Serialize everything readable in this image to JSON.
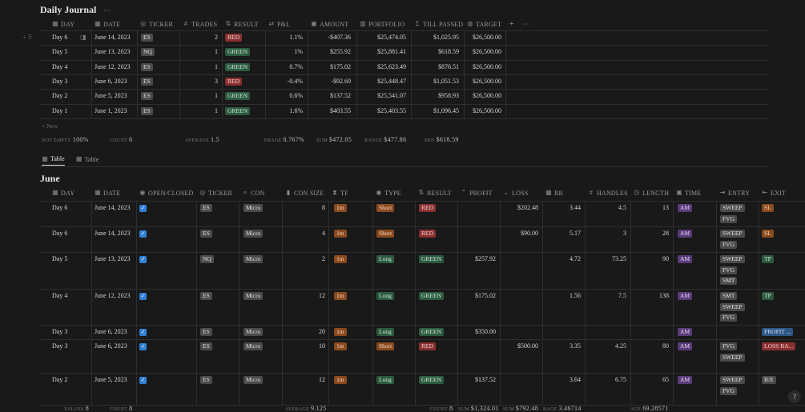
{
  "journal": {
    "title": "Daily Journal",
    "more": "···",
    "add_col": "+",
    "more_col": "···",
    "headers": [
      "DAY",
      "DATE",
      "TICKER",
      "TRADES",
      "RESULT",
      "P&L",
      "AMOUNT",
      "PORTFOLIO",
      "TILL PASSED",
      "TARGET"
    ],
    "rows": [
      {
        "day": "Day 6",
        "date": "June 14, 2023",
        "ticker": "ES",
        "trades": "2",
        "result": "RED",
        "pnl": "1.1%",
        "amount": "-$407.36",
        "portfolio": "$25,474.05",
        "till": "$1,025.95",
        "target": "$26,500.00"
      },
      {
        "day": "Day 5",
        "date": "June 13, 2023",
        "ticker": "NQ",
        "trades": "1",
        "result": "GREEN",
        "pnl": "1%",
        "amount": "$255.92",
        "portfolio": "$25,881.41",
        "till": "$618.59",
        "target": "$26,500.00"
      },
      {
        "day": "Day 4",
        "date": "June 12, 2023",
        "ticker": "ES",
        "trades": "1",
        "result": "GREEN",
        "pnl": "0.7%",
        "amount": "$175.02",
        "portfolio": "$25,623.49",
        "till": "$876.51",
        "target": "$26,500.00"
      },
      {
        "day": "Day 3",
        "date": "June 6, 2023",
        "ticker": "ES",
        "trades": "3",
        "result": "RED",
        "pnl": "-0.4%",
        "amount": "-$92.60",
        "portfolio": "$25,448.47",
        "till": "$1,051.53",
        "target": "$26,500.00"
      },
      {
        "day": "Day 2",
        "date": "June 5, 2023",
        "ticker": "ES",
        "trades": "1",
        "result": "GREEN",
        "pnl": "0.6%",
        "amount": "$137.52",
        "portfolio": "$25,541.07",
        "till": "$958.93",
        "target": "$26,500.00"
      },
      {
        "day": "Day 1",
        "date": "June 1, 2023",
        "ticker": "ES",
        "trades": "1",
        "result": "GREEN",
        "pnl": "1.6%",
        "amount": "$403.55",
        "portfolio": "$25,403.55",
        "till": "$1,096.45",
        "target": "$26,500.00"
      }
    ],
    "new_label": "+ New",
    "footer": {
      "not_empty_label": "NOT EMPTY",
      "not_empty": "100%",
      "count_label": "COUNT",
      "count": "6",
      "average_label": "AVERAGE",
      "average": "1.5",
      "erage_label": "ERAGE",
      "erage": "0.767%",
      "sum_label": "SUM",
      "sum": "$472.05",
      "range_label": "RANGE",
      "range": "$477.86",
      "min_label": "MIN",
      "min": "$618.59"
    }
  },
  "tabs": [
    {
      "label": "Table"
    },
    {
      "label": "Table"
    }
  ],
  "june": {
    "title": "June",
    "headers": [
      "DAY",
      "DATE",
      "OPEN/CLOSED",
      "TICKER",
      "CON",
      "CON SIZE",
      "TF",
      "TYPE",
      "RESULT",
      "PROFIT",
      "LOSS",
      "RR",
      "HANDLES",
      "LENGTH",
      "TIME",
      "ENTRY",
      "EXIT"
    ],
    "rows": [
      {
        "day": "Day 6",
        "date": "June 14, 2023",
        "ticker": "ES",
        "con": "Micro",
        "size": "8",
        "tf": "1m",
        "type": "Short",
        "result": "RED",
        "profit": "",
        "loss": "$202.48",
        "rr": "3.44",
        "handles": "4.5",
        "length": "13",
        "time": "AM",
        "entry": [
          "SWEEP",
          "FVG"
        ],
        "exit": "SL"
      },
      {
        "day": "Day 6",
        "date": "June 14, 2023",
        "ticker": "ES",
        "con": "Micro",
        "size": "4",
        "tf": "1m",
        "type": "Short",
        "result": "RED",
        "profit": "",
        "loss": "$90.00",
        "rr": "5.17",
        "handles": "3",
        "length": "28",
        "time": "AM",
        "entry": [
          "SWEEP",
          "FVG"
        ],
        "exit": "SL"
      },
      {
        "day": "Day 5",
        "date": "June 13, 2023",
        "ticker": "NQ",
        "con": "Micro",
        "size": "2",
        "tf": "1m",
        "type": "Long",
        "result": "GREEN",
        "profit": "$257.92",
        "loss": "",
        "rr": "4.72",
        "handles": "73.25",
        "length": "90",
        "time": "AM",
        "entry": [
          "SWEEP",
          "FVG",
          "SMT"
        ],
        "exit": "TP"
      },
      {
        "day": "Day 4",
        "date": "June 12, 2023",
        "ticker": "ES",
        "con": "Micro",
        "size": "12",
        "tf": "1m",
        "type": "Long",
        "result": "GREEN",
        "profit": "$175.02",
        "loss": "",
        "rr": "1.56",
        "handles": "7.5",
        "length": "138",
        "time": "AM",
        "entry": [
          "SMT",
          "SWEEP",
          "FVG"
        ],
        "exit": "TP"
      },
      {
        "day": "Day 3",
        "date": "June 6, 2023",
        "ticker": "ES",
        "con": "Micro",
        "size": "20",
        "tf": "1m",
        "type": "Long",
        "result": "GREEN",
        "profit": "$350.00",
        "loss": "",
        "rr": "",
        "handles": "",
        "length": "",
        "time": "AM",
        "entry": [],
        "exit": "PROFIT ..."
      },
      {
        "day": "Day 3",
        "date": "June 6, 2023",
        "ticker": "ES",
        "con": "Micro",
        "size": "10",
        "tf": "1m",
        "type": "Short",
        "result": "RED",
        "profit": "",
        "loss": "$500.00",
        "rr": "3.35",
        "handles": "4.25",
        "length": "80",
        "time": "AM",
        "entry": [
          "FVG",
          "SWEEP"
        ],
        "exit": "LOSS BA..."
      },
      {
        "day": "Day 2",
        "date": "June 5, 2023",
        "ticker": "ES",
        "con": "Micro",
        "size": "12",
        "tf": "1m",
        "type": "Long",
        "result": "GREEN",
        "profit": "$137.52",
        "loss": "",
        "rr": "3.64",
        "handles": "6.75",
        "length": "65",
        "time": "AM",
        "entry": [
          "SWEEP",
          "FVG"
        ],
        "exit": "B/E"
      }
    ],
    "footer": {
      "values_label": "VALUES",
      "values": "8",
      "count_label": "COUNT",
      "count": "8",
      "average_label": "AVERAGE",
      "average": "9.125",
      "count2_label": "COUNT",
      "count2": "8",
      "sum_label": "SUM",
      "sum": "$1,324.01",
      "sum2_label": "SUM",
      "sum2": "$792.48",
      "rage_label": "RAGE",
      "rage": "3.46714",
      "age_label": "AGE",
      "age": "69.28571"
    }
  },
  "help": "?",
  "colors": {
    "accent": "#2f80d6",
    "red": "#8a2f2f",
    "green": "#2c5a3f",
    "orange": "#8a4a1e",
    "purple": "#5a3b7a",
    "gray": "#4a4a4a"
  }
}
